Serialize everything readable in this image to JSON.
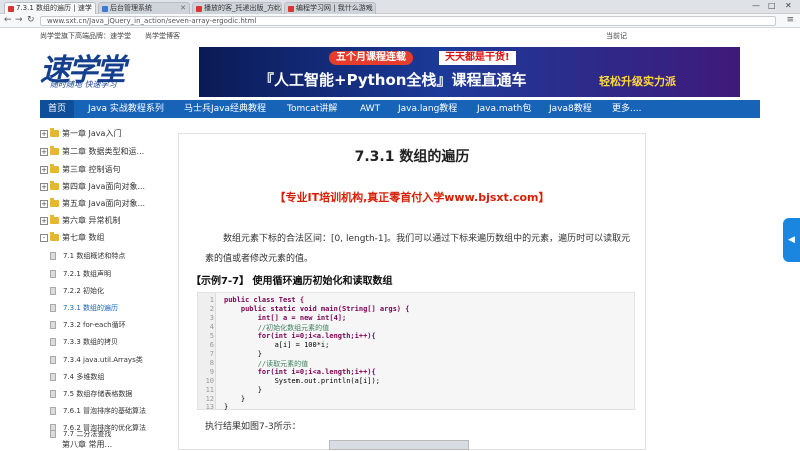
{
  "browser": {
    "tabs": [
      {
        "label": "7.3.1 数组的遍历 | 速学",
        "color": "#d33"
      },
      {
        "label": "后台管理系统",
        "color": "#3a7bd5"
      },
      {
        "label": "播放的客_托递出版_方比",
        "color": "#d33"
      },
      {
        "label": "编程学习网 | 我什么游戏",
        "color": "#d33"
      }
    ],
    "window_buttons": [
      "—",
      "□",
      "✕"
    ],
    "url": "www.sxt.cn/Java_jQuery_in_action/seven-array-ergodic.html"
  },
  "site": {
    "brand_text": "尚学堂旗下高端品牌：速学堂　　尚学堂博客",
    "today_text": "当前记",
    "logo_main": "速学堂",
    "logo_tag": "随时随地 快速学习",
    "banner": {
      "pill1": "五个月课程连载",
      "pill2": "天天都是干货!",
      "main": "『人工智能+Python全栈』课程直通车",
      "sub": "轻松升级实力派"
    }
  },
  "nav": [
    "首页",
    "Java 实战教程系列",
    "马士兵Java经典教程",
    "Tomcat讲解",
    "AWT",
    "Java.lang教程",
    "Java.math包",
    "Java8教程",
    "更多...."
  ],
  "sidebar": {
    "chapters": [
      {
        "toggle": "+",
        "label": "第一章 Java入门"
      },
      {
        "toggle": "+",
        "label": "第二章 数据类型和运..."
      },
      {
        "toggle": "+",
        "label": "第三章 控制语句"
      },
      {
        "toggle": "+",
        "label": "第四章 Java面向对象..."
      },
      {
        "toggle": "+",
        "label": "第五章 Java面向对象..."
      },
      {
        "toggle": "+",
        "label": "第六章 异常机制"
      },
      {
        "toggle": "-",
        "label": "第七章 数组"
      }
    ],
    "sections": [
      "7.1 数组概述和特点",
      "7.2.1 数组声明",
      "7.2.2 初始化",
      "7.3.1 数组的遍历",
      "7.3.2 for-each循环",
      "7.3.3 数组的拷贝",
      "7.3.4 java.util.Arrays类",
      "7.4 多维数组",
      "7.5 数组存储表格数据",
      "7.6.1 冒泡排序的基础算法",
      "7.6.2 冒泡排序的优化算法",
      "7.7 二分法查找",
      "第八章 常用..."
    ],
    "active_section": 3
  },
  "article": {
    "title": "7.3.1 数组的遍历",
    "promo": "【专业IT培训机构,真正零首付入学www.bjsxt.com】",
    "paragraph": "数组元素下标的合法区间：[0, length-1]。我们可以通过下标来遍历数组中的元素，遍历时可以读取元素的值或者修改元素的值。",
    "example_title": "【示例7-7】 使用循环遍历初始化和读取数组",
    "code_lines": [
      "public class Test {",
      "    public static void main(String[] args) {",
      "        int[] a = new int[4];",
      "        //初始化数组元素的值",
      "        for(int i=0;i<a.length;i++){",
      "            a[i] = 100*i;",
      "        }",
      "        //读取元素的值",
      "        for(int i=0;i<a.length;i++){",
      "            System.out.println(a[i]);",
      "        }",
      "    }",
      "}"
    ],
    "line_numbers": [
      "1",
      "2",
      "3",
      "4",
      "5",
      "6",
      "7",
      "8",
      "9",
      "10",
      "11",
      "12",
      "13"
    ],
    "result_text": "执行结果如图7-3所示："
  },
  "side_button": "◀"
}
